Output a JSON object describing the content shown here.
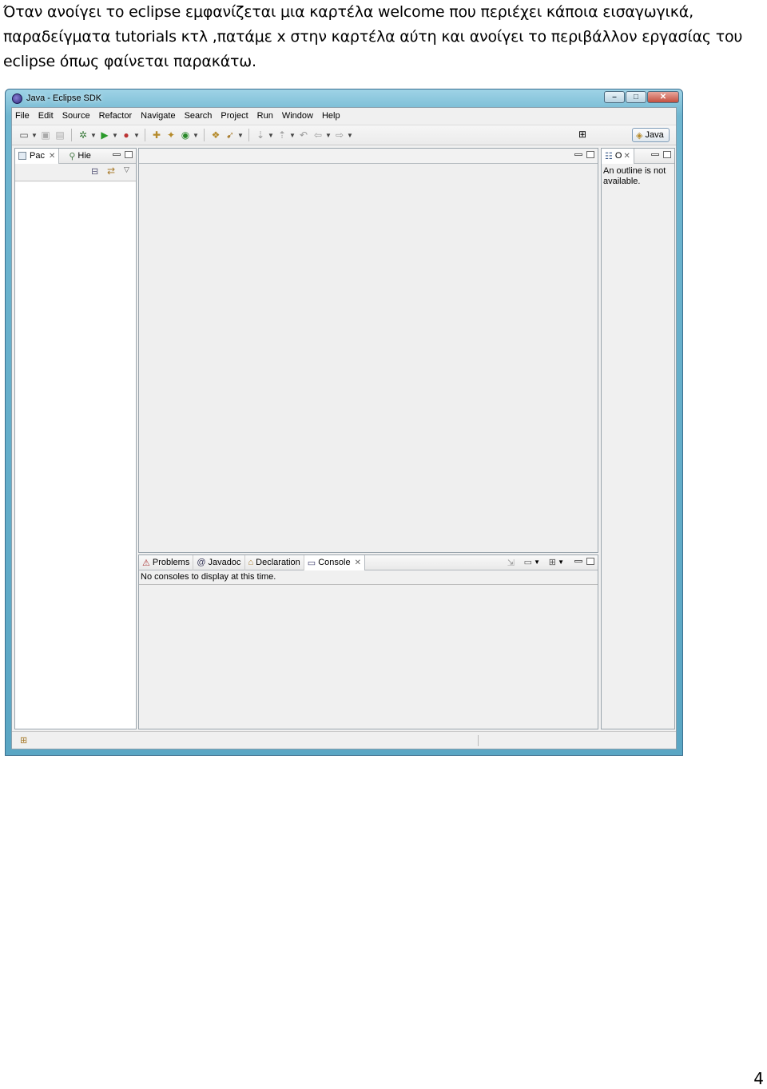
{
  "intro": {
    "line1": "Όταν ανοίγει το eclipse εμφανίζεται μια καρτέλα welcome που περιέχει κάποια εισαγωγικά,",
    "line2": "παραδείγματα tutorials κτλ ,πατάμε x στην καρτέλα αύτη και ανοίγει το περιβάλλον εργασίας του",
    "line3": "eclipse όπως φαίνεται παρακάτω."
  },
  "window": {
    "title": "Java - Eclipse SDK",
    "controls": {
      "minimize": "–",
      "maximize": "□",
      "close": "✕"
    }
  },
  "menu": [
    {
      "label": "File"
    },
    {
      "label": "Edit"
    },
    {
      "label": "Source"
    },
    {
      "label": "Refactor"
    },
    {
      "label": "Navigate"
    },
    {
      "label": "Search"
    },
    {
      "label": "Project"
    },
    {
      "label": "Run"
    },
    {
      "label": "Window"
    },
    {
      "label": "Help"
    }
  ],
  "perspective": {
    "label": "Java"
  },
  "left_view": {
    "tab1": "Pac",
    "tab2": "Hie"
  },
  "outline_view": {
    "tab": "O",
    "message": "An outline is not available."
  },
  "bottom_view": {
    "tabs": [
      "Problems",
      "Javadoc",
      "Declaration",
      "Console"
    ],
    "console_message": "No consoles to display at this time."
  },
  "page_number": "4"
}
